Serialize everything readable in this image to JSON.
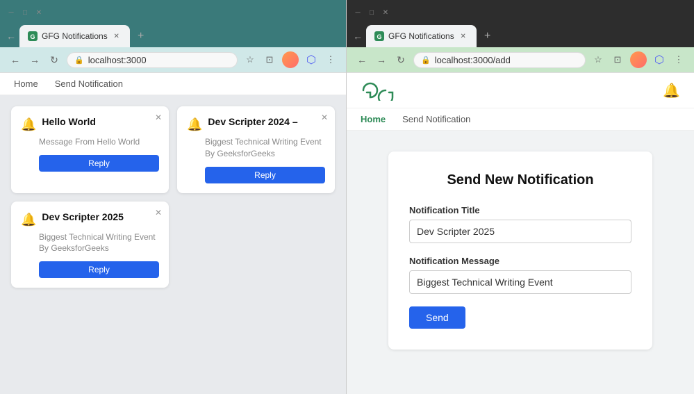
{
  "left_browser": {
    "title": "GFG Notifications",
    "url": "localhost:3000",
    "nav": {
      "home": "Home",
      "send": "Send Notification"
    },
    "cards": [
      {
        "id": 1,
        "title": "Hello World",
        "message": "Message From Hello World",
        "reply_label": "Reply"
      },
      {
        "id": 2,
        "title": "Dev Scripter 2024 –",
        "message": "Biggest Technical Writing Event By GeeksforGeeks",
        "reply_label": "Reply"
      },
      {
        "id": 3,
        "title": "Dev Scripter 2025",
        "message": "Biggest Technical Writing Event By GeeksforGeeks",
        "reply_label": "Reply"
      }
    ]
  },
  "right_browser": {
    "title": "GFG Notifications",
    "url": "localhost:3000/add",
    "logo_text": "ɐ͜ͱ",
    "bell_icon": "🔔",
    "nav": {
      "home": "Home",
      "send": "Send Notification"
    },
    "page_title": "Send New Notification",
    "form": {
      "title_label": "Notification Title",
      "title_value": "Dev Scripter 2025",
      "title_placeholder": "Notification Title",
      "message_label": "Notification Message",
      "message_value": "Biggest Technical Writing Event",
      "message_placeholder": "Notification Message",
      "send_label": "Send"
    }
  }
}
